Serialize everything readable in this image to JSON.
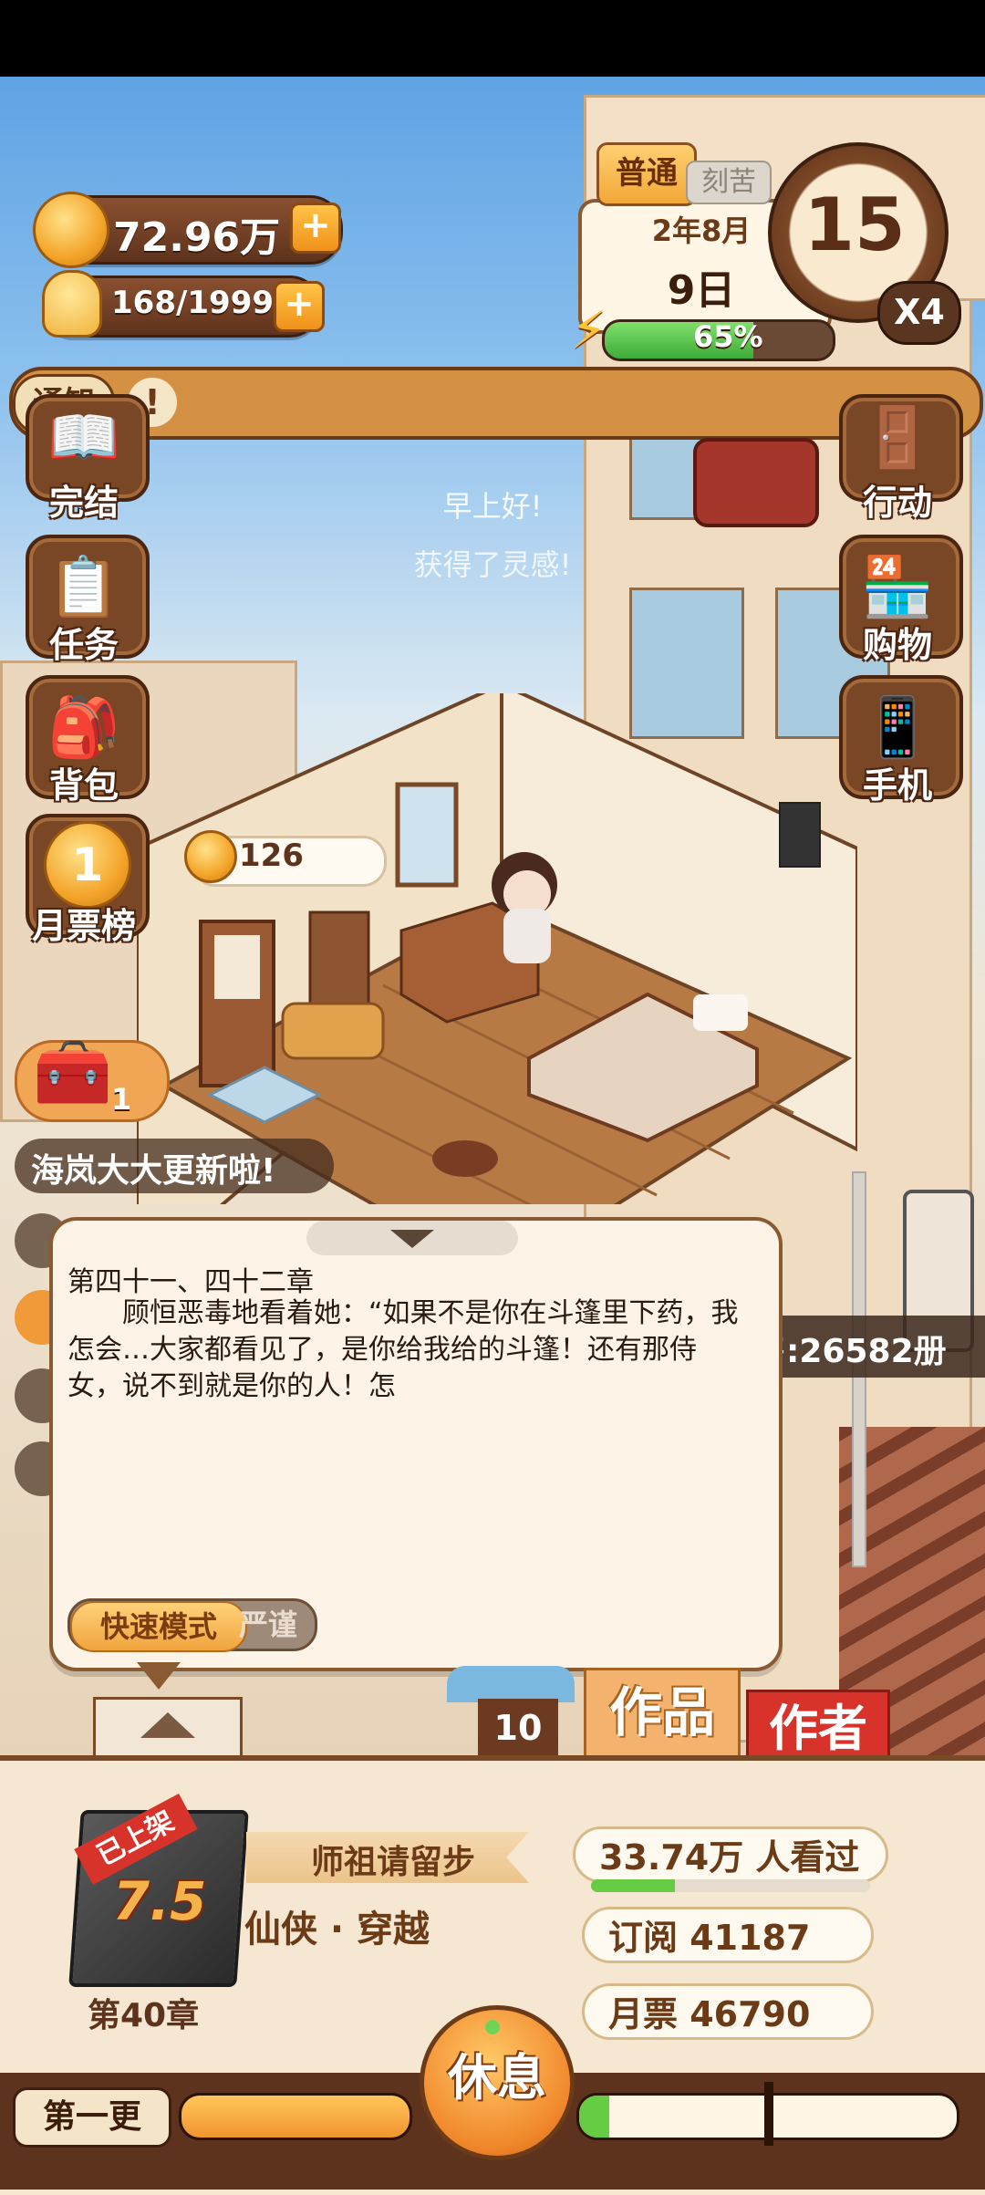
{
  "resources": {
    "coins": "72.96万",
    "inspiration": "168/1999"
  },
  "date_panel": {
    "difficulty_tag": "普通",
    "secondary_tag": "刻苦",
    "year_month": "2年8月",
    "day": "9日",
    "energy_percent_label": "65%",
    "energy_percent": 65,
    "clock_value": "15",
    "speed": "X4"
  },
  "notice": {
    "tag": "通知",
    "text": "!"
  },
  "left_menu": [
    {
      "label": "完结",
      "icon": "book-icon"
    },
    {
      "label": "任务",
      "icon": "checklist-icon"
    },
    {
      "label": "背包",
      "icon": "backpack-icon"
    },
    {
      "label": "月票榜",
      "icon": "ticket-rank-icon"
    }
  ],
  "right_menu": [
    {
      "label": "行动",
      "icon": "door-icon"
    },
    {
      "label": "购物",
      "icon": "shop-icon"
    },
    {
      "label": "手机",
      "icon": "phone-icon"
    }
  ],
  "floating_messages": [
    "早上好!",
    "获得了灵感!"
  ],
  "room_coin": "126",
  "treasure_count": "1",
  "update_banner": "海岚大大更新啦!",
  "sales": "售:26582册",
  "dialog": {
    "chapter_title": "第四十一、四十二章",
    "body": "　　顾恒恶毒地看着她：“如果不是你在斗篷里下药，我怎会…大家都看见了，是你给我给的斗篷！还有那侍女，说不到就是你的人！怎",
    "mode_fast": "快速模式",
    "mode_strict": "严谨"
  },
  "tabs": {
    "count": "10",
    "works": "作品",
    "author": "作者"
  },
  "book": {
    "status_badge": "已上架",
    "rating": "7.5",
    "title": "师祖请留步",
    "genre": "仙侠 · 穿越",
    "chapter": "第40章",
    "views": "33.74万 人看过",
    "views_progress": 0.3,
    "subscriptions": "订阅 41187",
    "monthly_tickets": "月票 46790"
  },
  "bottom_bar": {
    "update_label": "第一更",
    "rest_button": "休息",
    "left_progress": 1.0,
    "right_progress": 0.08
  },
  "colors": {
    "wood_dark": "#5e331d",
    "accent_orange": "#f0921a",
    "panel_bg": "#f5e7d2",
    "red_tab": "#d8332a"
  }
}
